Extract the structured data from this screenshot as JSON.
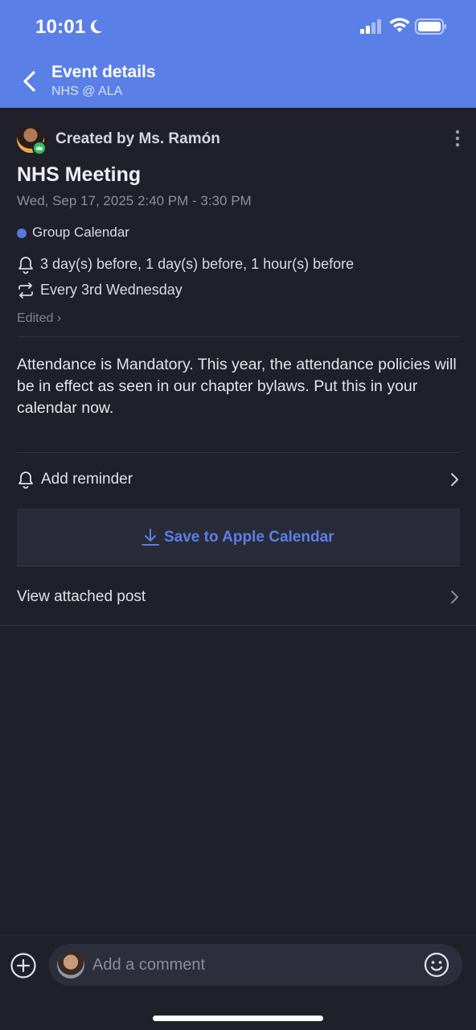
{
  "status_bar": {
    "time": "10:01"
  },
  "header": {
    "title": "Event details",
    "subtitle": "NHS @ ALA"
  },
  "event": {
    "created_by": "Created by Ms. Ramón",
    "title": "NHS Meeting",
    "datetime": "Wed, Sep 17, 2025 2:40 PM - 3:30 PM",
    "calendar": "Group Calendar",
    "calendar_color": "#5876e0",
    "reminders": "3 day(s) before, 1 day(s) before, 1 hour(s) before",
    "recurrence": "Every 3rd Wednesday",
    "edited": "Edited ›",
    "description": "Attendance is Mandatory. This year, the attendance policies will be in effect as seen in our chapter bylaws. Put this in your calendar now."
  },
  "actions": {
    "add_reminder": "Add reminder",
    "save_calendar": "Save to Apple Calendar",
    "view_post": "View attached post"
  },
  "composer": {
    "placeholder": "Add a comment"
  },
  "colors": {
    "accent": "#5a7fe6",
    "background": "#1f2029",
    "badge": "#2fbf5b"
  }
}
